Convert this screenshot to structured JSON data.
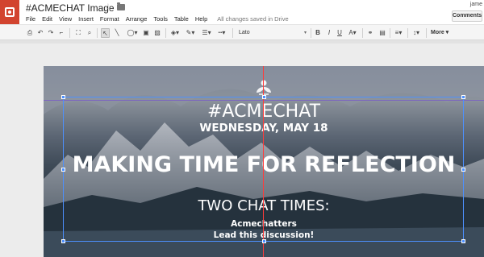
{
  "app": {
    "title": "#ACMECHAT Image",
    "save_status": "All changes saved in Drive",
    "user": "jame",
    "comments_label": "Comments"
  },
  "menu": [
    "File",
    "Edit",
    "View",
    "Insert",
    "Format",
    "Arrange",
    "Tools",
    "Table",
    "Help"
  ],
  "toolbar": {
    "font_name": "Lato",
    "bold": "B",
    "italic": "I",
    "underline": "U",
    "more_label": "More"
  },
  "slide": {
    "hashtag": "#ACMECHAT",
    "date": "WEDNESDAY, MAY 18",
    "headline": "MAKING TIME FOR REFLECTION",
    "times_heading": "TWO CHAT TIMES:",
    "line1": "Acmechatters",
    "line2": "Lead this discussion!"
  },
  "colors": {
    "accent": "#d2442f",
    "selection": "#4d90fe",
    "guide": "#ff3b3b"
  }
}
